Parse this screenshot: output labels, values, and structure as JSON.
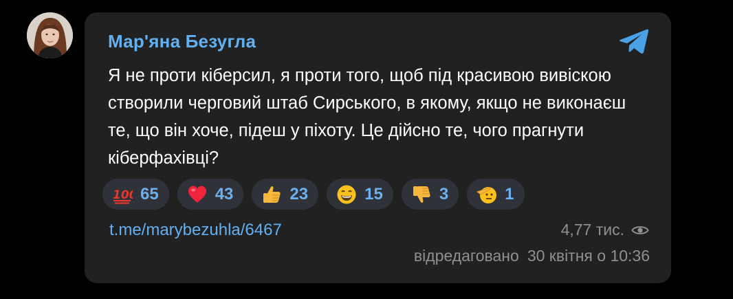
{
  "post": {
    "author": "Мар'яна Безугла",
    "text": "Я не проти кіберсил, я проти того, щоб під красивою вивіскою створили черговий штаб Сирського, в якому, якщо не виконаєш те, що він хоче, підеш у піхоту. Це дійсно те, чого прагнути кіберфахівці?",
    "link": "t.me/marybezuhla/6467",
    "views": "4,77 тис.",
    "edited_label": "відредаговано",
    "date": "30 квітня о 10:36"
  },
  "reactions": [
    {
      "icon": "hundred-points-icon",
      "count": "65"
    },
    {
      "icon": "red-heart-icon",
      "count": "43"
    },
    {
      "icon": "thumbs-up-icon",
      "count": "23"
    },
    {
      "icon": "grinning-face-icon",
      "count": "15"
    },
    {
      "icon": "thumbs-down-icon",
      "count": "3"
    },
    {
      "icon": "saluting-face-icon",
      "count": "1"
    }
  ],
  "colors": {
    "background": "#000000",
    "card": "#212121",
    "accent": "#62b0f2",
    "reaction_bg": "#2f3238",
    "muted": "#8f9093"
  }
}
